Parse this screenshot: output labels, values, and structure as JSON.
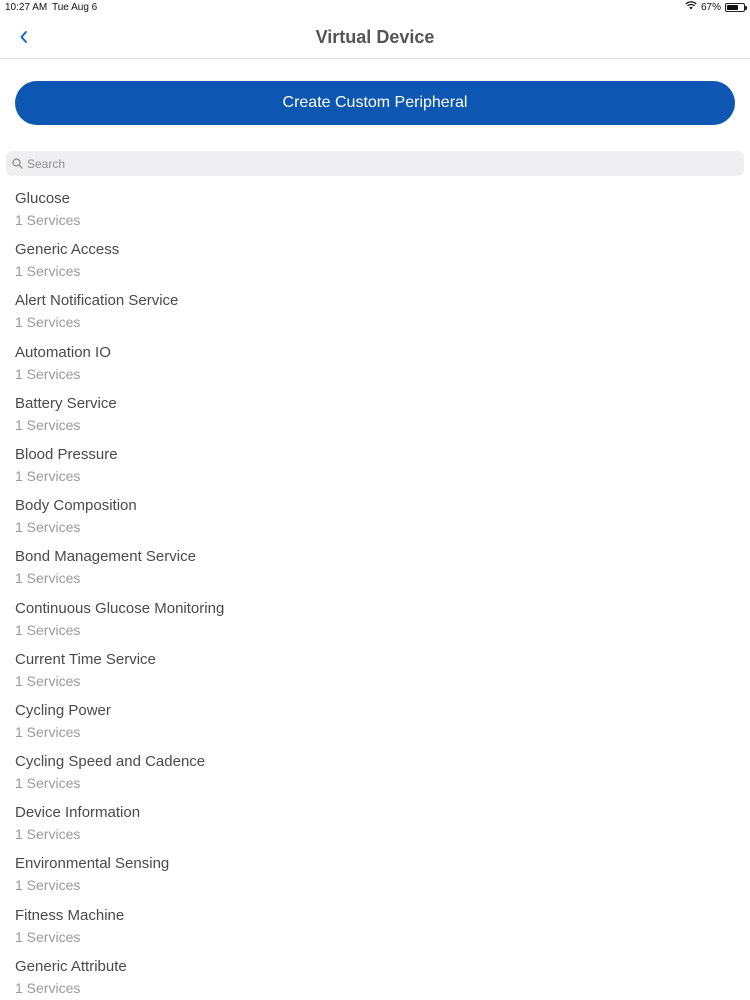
{
  "status_bar": {
    "time": "10:27 AM",
    "date": "Tue Aug 6",
    "battery": "67%",
    "battery_level": 0.67
  },
  "nav": {
    "title": "Virtual Device",
    "back_icon": "chevron-left-icon"
  },
  "create_button": {
    "label": "Create Custom Peripheral",
    "color": "#0d57b3"
  },
  "search": {
    "placeholder": "Search",
    "value": ""
  },
  "peripherals": [
    {
      "name": "Glucose",
      "services": "1 Services"
    },
    {
      "name": "Generic Access",
      "services": "1 Services"
    },
    {
      "name": "Alert Notification Service",
      "services": "1 Services"
    },
    {
      "name": "Automation IO",
      "services": "1 Services"
    },
    {
      "name": "Battery Service",
      "services": "1 Services"
    },
    {
      "name": "Blood Pressure",
      "services": "1 Services"
    },
    {
      "name": "Body Composition",
      "services": "1 Services"
    },
    {
      "name": "Bond Management Service",
      "services": "1 Services"
    },
    {
      "name": "Continuous Glucose Monitoring",
      "services": "1 Services"
    },
    {
      "name": "Current Time Service",
      "services": "1 Services"
    },
    {
      "name": "Cycling Power",
      "services": "1 Services"
    },
    {
      "name": "Cycling Speed and Cadence",
      "services": "1 Services"
    },
    {
      "name": "Device Information",
      "services": "1 Services"
    },
    {
      "name": "Environmental Sensing",
      "services": "1 Services"
    },
    {
      "name": "Fitness Machine",
      "services": "1 Services"
    },
    {
      "name": "Generic Attribute",
      "services": "1 Services"
    }
  ]
}
